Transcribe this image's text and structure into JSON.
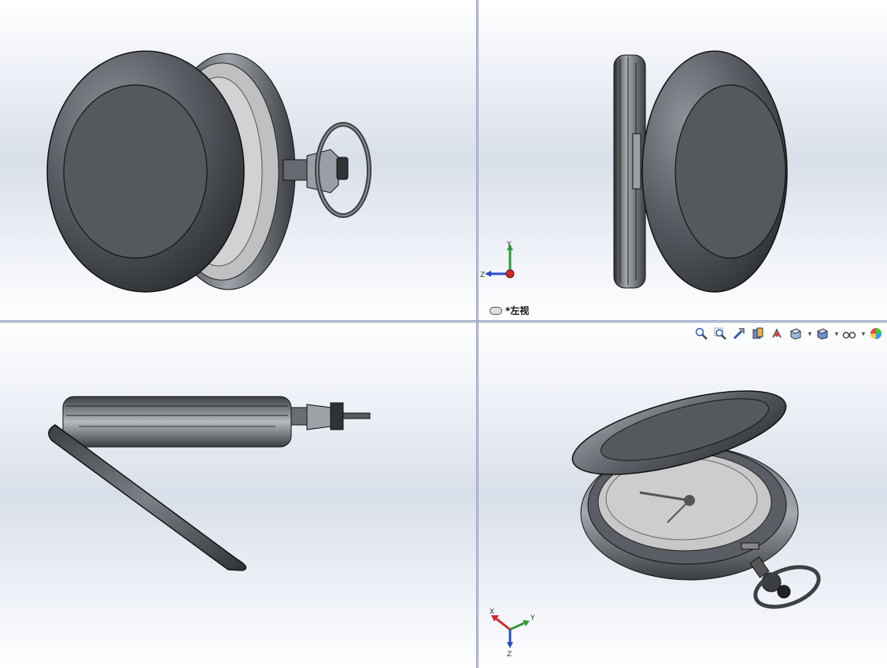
{
  "viewports": {
    "top_left": {
      "name": "front-view"
    },
    "top_right": {
      "name": "left-view",
      "label": "*左视"
    },
    "bottom_left": {
      "name": "top-view"
    },
    "bottom_right": {
      "name": "isometric-view"
    }
  },
  "triad": {
    "x": "X",
    "y": "Y",
    "z": "Z"
  },
  "toolbar": {
    "items": [
      "zoom-to-fit-icon",
      "zoom-to-area-icon",
      "previous-view-icon",
      "section-view-icon",
      "dynamic-annotation-icon",
      "view-orientation-icon",
      "display-style-icon",
      "hide-show-items-icon",
      "edit-appearance-icon"
    ]
  },
  "colors": {
    "body": "#4a4d52",
    "body_light": "#8a8e95",
    "dial": "#c9c9c9",
    "triad_x": "#d12b2b",
    "triad_y": "#2f9a3a",
    "triad_z": "#2a4fc9"
  }
}
